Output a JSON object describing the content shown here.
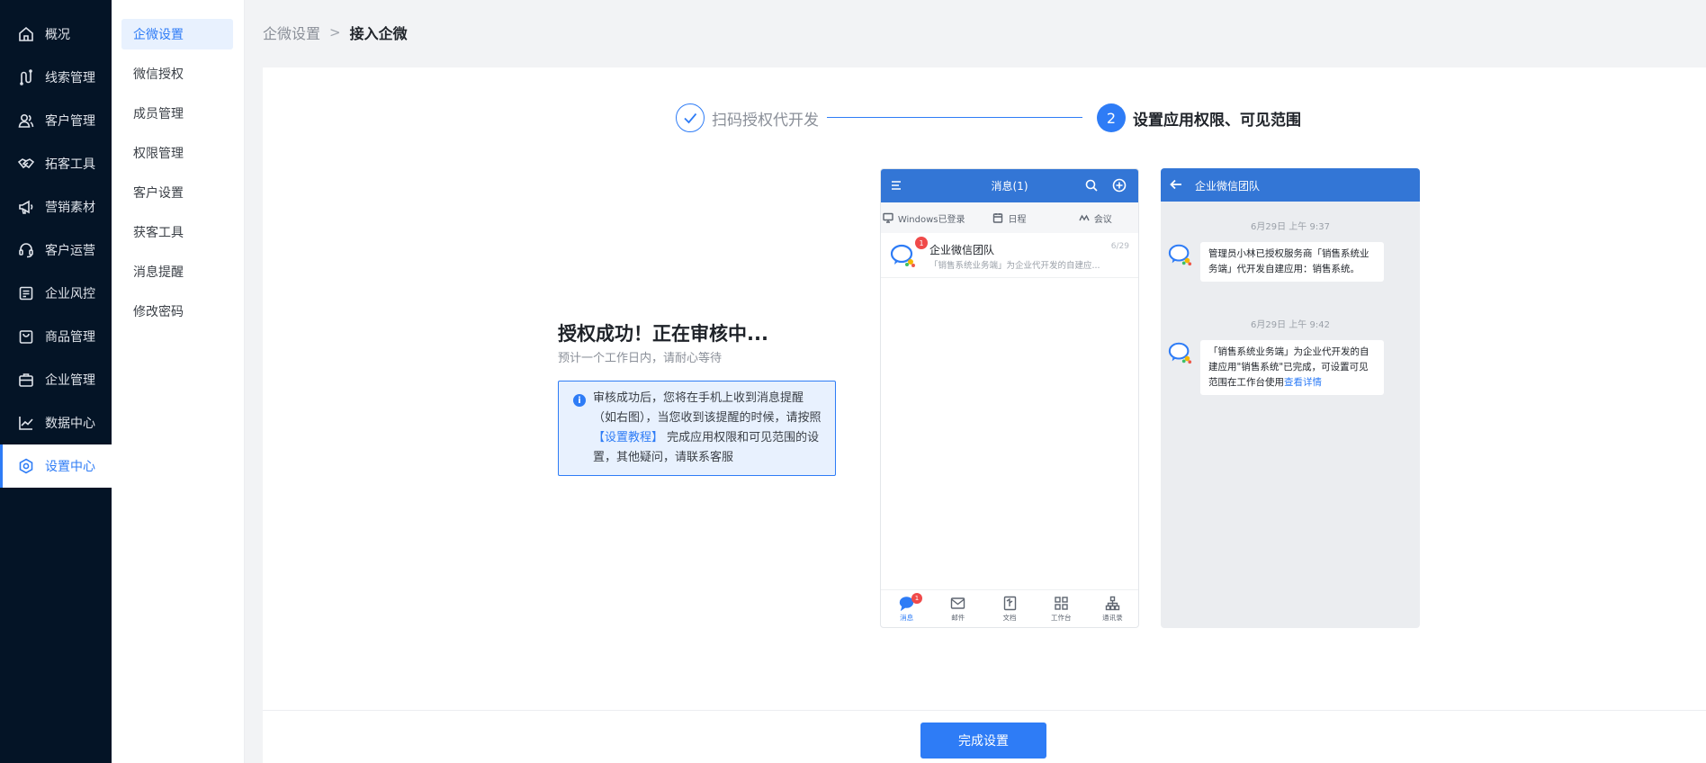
{
  "main_nav": {
    "items": [
      {
        "label": "概况",
        "icon": "home-icon"
      },
      {
        "label": "线索管理",
        "icon": "route-icon"
      },
      {
        "label": "客户管理",
        "icon": "users-icon"
      },
      {
        "label": "拓客工具",
        "icon": "handshake-icon"
      },
      {
        "label": "营销素材",
        "icon": "megaphone-icon"
      },
      {
        "label": "客户运营",
        "icon": "support-icon"
      },
      {
        "label": "企业风控",
        "icon": "shield-list-icon"
      },
      {
        "label": "商品管理",
        "icon": "bag-icon"
      },
      {
        "label": "企业管理",
        "icon": "briefcase-icon"
      },
      {
        "label": "数据中心",
        "icon": "chart-line-icon"
      },
      {
        "label": "设置中心",
        "icon": "gear-icon"
      }
    ],
    "active_index": 10
  },
  "sub_nav": {
    "items": [
      "企微设置",
      "微信授权",
      "成员管理",
      "权限管理",
      "客户设置",
      "获客工具",
      "消息提醒",
      "修改密码"
    ],
    "active_index": 0
  },
  "breadcrumb": {
    "parent": "企微设置",
    "current": "接入企微"
  },
  "steps": {
    "step1": {
      "label": "扫码授权代开发",
      "state": "done"
    },
    "step2": {
      "number": "2",
      "label": "设置应用权限、可见范围",
      "state": "active"
    }
  },
  "status": {
    "title": "授权成功！正在审核中...",
    "subtitle": "预计一个工作日内，请耐心等待",
    "notice_icon": "i",
    "notice_before": "审核成功后，您将在手机上收到消息提醒（如右图），当您收到该提醒的时候，请按照",
    "notice_link": "【设置教程】",
    "notice_after": "完成应用权限和可见范围的设置，其他疑问，请联系客服"
  },
  "phone_list": {
    "title": "消息(1)",
    "tabs": [
      {
        "label": "Windows已登录",
        "icon": "monitor-icon"
      },
      {
        "label": "日程",
        "icon": "calendar-icon"
      },
      {
        "label": "会议",
        "icon": "meeting-icon"
      }
    ],
    "message": {
      "name": "企业微信团队",
      "badge": "1",
      "date": "6/29",
      "preview": "「销售系统业务端」为企业代开发的自建应..."
    },
    "bottom_tabs": [
      {
        "label": "消息",
        "icon": "chat-bubble-icon",
        "badge": "1"
      },
      {
        "label": "邮件",
        "icon": "mail-icon"
      },
      {
        "label": "文档",
        "icon": "document-icon"
      },
      {
        "label": "工作台",
        "icon": "grid-icon"
      },
      {
        "label": "通讯录",
        "icon": "org-chart-icon"
      }
    ],
    "active_bottom_tab": 0
  },
  "phone_chat": {
    "title": "企业微信团队",
    "messages": [
      {
        "time": "6月29日 上午 9:37",
        "text": "管理员小林已授权服务商「销售系统业务端」代开发自建应用：销售系统。"
      },
      {
        "time": "6月29日 上午 9:42",
        "text": "「销售系统业务端」为企业代开发的自建应用\"销售系统\"已完成，可设置可见范围在工作台使用",
        "link": "查看详情"
      }
    ]
  },
  "footer": {
    "done_button": "完成设置"
  },
  "colors": {
    "primary": "#2e7cf6",
    "nav_bg": "#041426",
    "phone_header": "#3376d6",
    "badge": "#f04a4a"
  }
}
